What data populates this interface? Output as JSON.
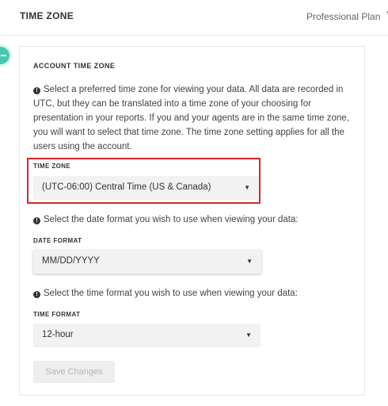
{
  "header": {
    "title": "TIME ZONE",
    "plan": "Professional Plan",
    "plan_caret": "▼"
  },
  "account_time_zone": {
    "section_title": "ACCOUNT TIME ZONE",
    "description": "Select a preferred time zone for viewing your data. All data are recorded in UTC, but they can be translated into a time zone of your choosing for presentation in your reports. If you and your agents are in the same time zone, you will want to select that time zone. The time zone setting applies for all the users using the account.",
    "time_zone": {
      "label": "TIME ZONE",
      "value": "(UTC-06:00) Central Time (US & Canada)"
    },
    "date_format": {
      "hint": "Select the date format you wish to use when viewing your data:",
      "label": "DATE FORMAT",
      "value": "MM/DD/YYYY"
    },
    "time_format": {
      "hint": "Select the time format you wish to use when viewing your data:",
      "label": "TIME FORMAT",
      "value": "12-hour"
    },
    "save_label": "Save Changes"
  },
  "icons": {
    "info": "info-circle-icon",
    "caret": "caret-down-icon",
    "collapse": "minus-icon"
  },
  "colors": {
    "accent": "#45c9ae",
    "highlight_border": "#d32a2a"
  }
}
